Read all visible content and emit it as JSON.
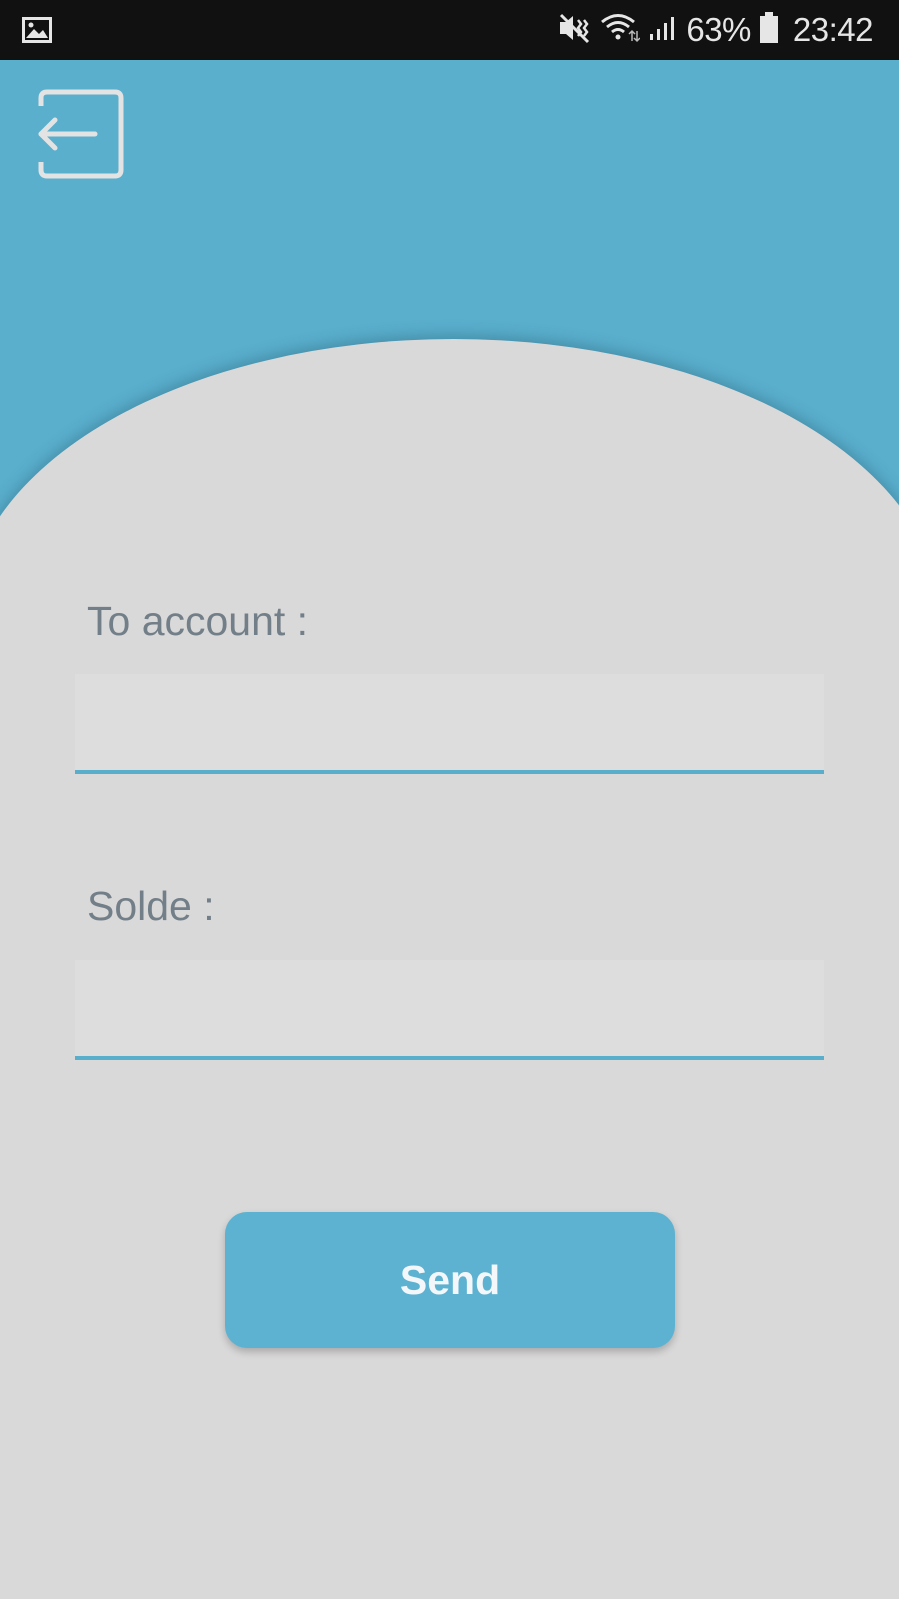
{
  "status_bar": {
    "battery_percent": "63%",
    "time": "23:42",
    "icons": [
      "gallery-icon",
      "vibrate-mute-icon",
      "wifi-icon",
      "signal-icon",
      "battery-icon"
    ]
  },
  "header": {
    "back_icon": "logout-arrow-icon",
    "color": "#5aafcd"
  },
  "form": {
    "to_account_label": "To account :",
    "to_account_value": "",
    "solde_label": "Solde :",
    "solde_value": "",
    "send_label": "Send"
  },
  "colors": {
    "accent": "#5aafcd",
    "background": "#dad9d9",
    "label": "#737f88"
  }
}
